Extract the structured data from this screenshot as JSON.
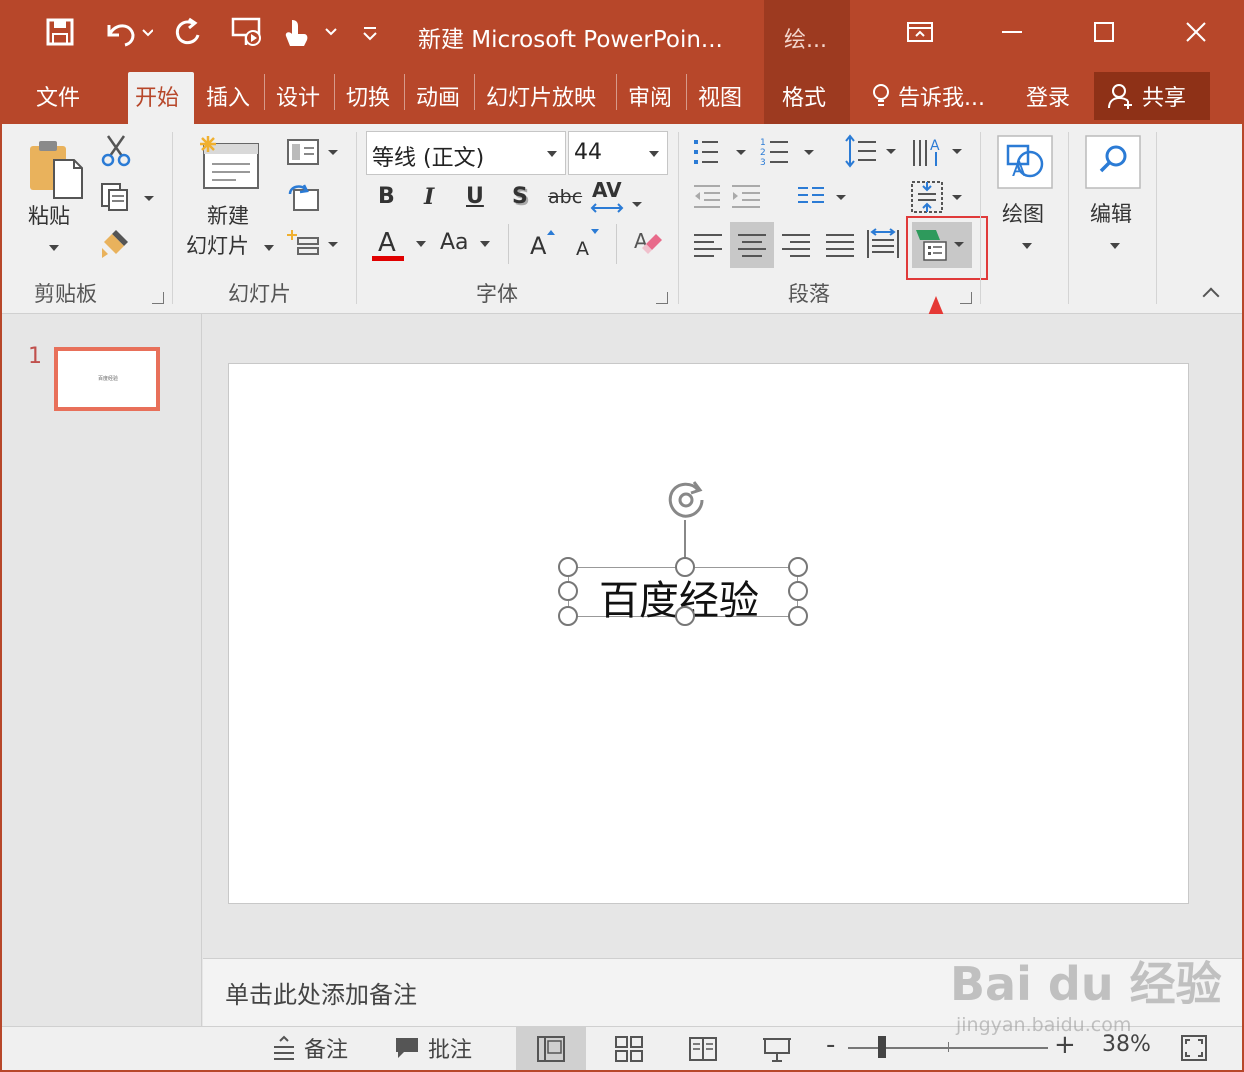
{
  "window": {
    "title": "新建 Microsoft PowerPoin...",
    "context_group": "绘...",
    "accent_color": "#b7472a"
  },
  "quick_access": {
    "save_icon": "save-icon",
    "undo_icon": "undo-icon",
    "redo_icon": "redo-icon",
    "slideshow_icon": "present-from-start-icon",
    "touch_icon": "touch-mode-icon",
    "customize_icon": "customize-qat-icon"
  },
  "tabs": {
    "file": "文件",
    "home": "开始",
    "insert": "插入",
    "design": "设计",
    "transitions": "切换",
    "animations": "动画",
    "slideshow": "幻灯片放映",
    "review": "审阅",
    "view": "视图",
    "format": "格式",
    "tell_me": "告诉我...",
    "signin": "登录",
    "share": "共享"
  },
  "ribbon": {
    "clipboard": {
      "paste": "粘贴",
      "group_label": "剪贴板"
    },
    "slides": {
      "new_slide_line1": "新建",
      "new_slide_line2": "幻灯片",
      "group_label": "幻灯片"
    },
    "font": {
      "font_name": "等线 (正文)",
      "font_size": "44",
      "bold": "B",
      "italic": "I",
      "underline": "U",
      "shadow": "S",
      "strike": "abc",
      "spacing": "AV",
      "font_color": "A",
      "change_case": "Aa",
      "grow": "A",
      "shrink": "A",
      "group_label": "字体"
    },
    "paragraph": {
      "group_label": "段落"
    },
    "drawing": {
      "label": "绘图"
    },
    "editing": {
      "label": "编辑"
    }
  },
  "slides_pane": {
    "slide_number": "1",
    "thumb_text": "百度经验"
  },
  "slide": {
    "textbox_text": "百度经验"
  },
  "notes": {
    "placeholder": "单击此处添加备注"
  },
  "statusbar": {
    "notes": "备注",
    "comments": "批注",
    "zoom_minus": "-",
    "zoom_plus": "+",
    "zoom": "38%"
  },
  "watermark": {
    "brand": "Bai du 经验",
    "url": "jingyan.baidu.com"
  }
}
